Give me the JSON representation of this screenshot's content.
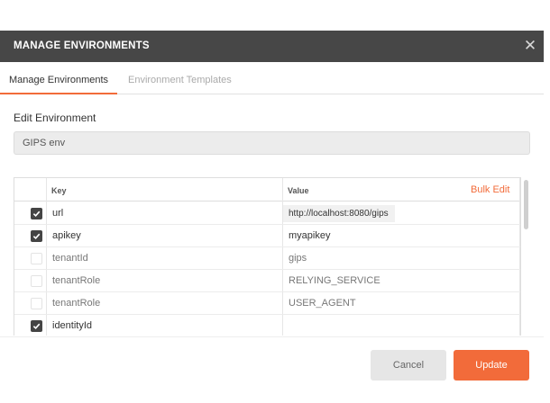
{
  "dialog": {
    "title": "MANAGE ENVIRONMENTS",
    "close_icon": "close-icon"
  },
  "tabs": [
    {
      "label": "Manage Environments",
      "active": true
    },
    {
      "label": "Environment Templates",
      "active": false
    }
  ],
  "edit": {
    "section_title": "Edit Environment",
    "environment_name": "GIPS env"
  },
  "table": {
    "headers": {
      "key": "Key",
      "value": "Value"
    },
    "bulk_edit_label": "Bulk Edit",
    "rows": [
      {
        "enabled": true,
        "key": "url",
        "value": "http://localhost:8080/gips"
      },
      {
        "enabled": true,
        "key": "apikey",
        "value": "myapikey"
      },
      {
        "enabled": false,
        "key": "tenantId",
        "value": "gips"
      },
      {
        "enabled": false,
        "key": "tenantRole",
        "value": "RELYING_SERVICE"
      },
      {
        "enabled": false,
        "key": "tenantRole",
        "value": "USER_AGENT"
      },
      {
        "enabled": true,
        "key": "identityId",
        "value": ""
      }
    ]
  },
  "footer": {
    "cancel_label": "Cancel",
    "update_label": "Update"
  },
  "colors": {
    "accent": "#f26b3a",
    "titlebar": "#474747"
  }
}
